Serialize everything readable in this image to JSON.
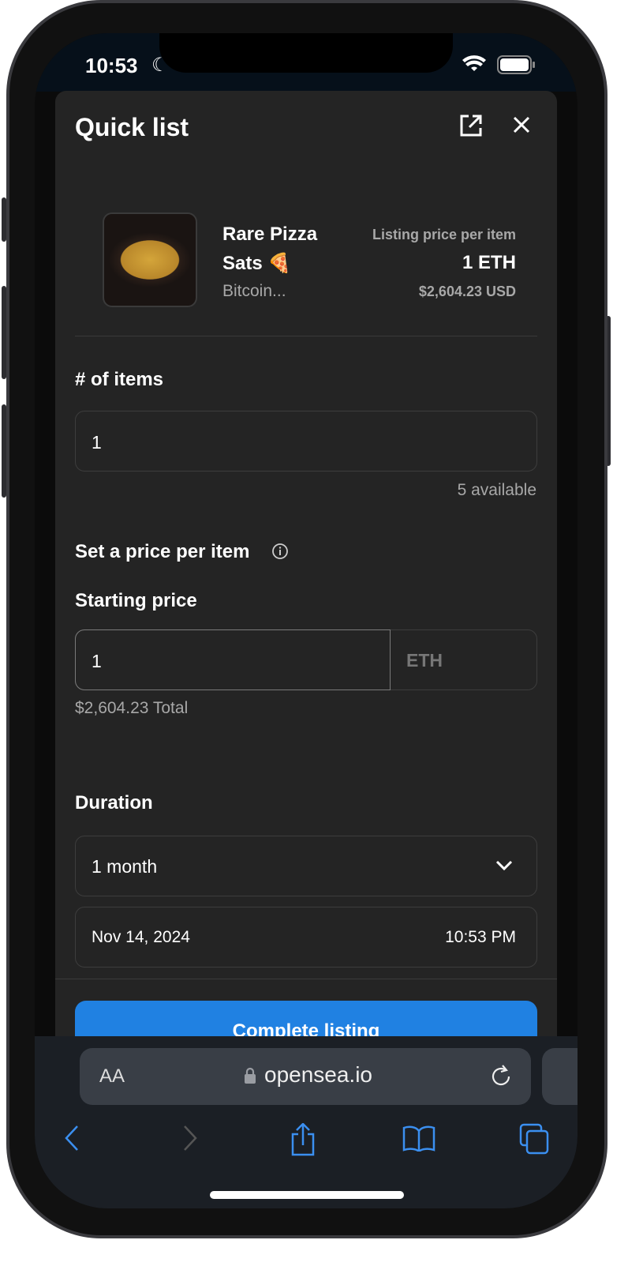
{
  "status_bar": {
    "time": "10:53"
  },
  "modal": {
    "title": "Quick list",
    "item": {
      "name_line1": "Rare Pizza",
      "name_line2": "Sats 🍕",
      "collection": "Bitcoin...",
      "price_label": "Listing price per item",
      "price": "1 ETH",
      "price_usd": "$2,604.23 USD"
    },
    "items_label": "# of items",
    "items_value": "1",
    "available": "5 available",
    "set_price_label": "Set a price per item",
    "starting_price_label": "Starting price",
    "starting_price_value": "1",
    "currency": "ETH",
    "total": "$2,604.23 Total",
    "duration_label": "Duration",
    "duration_value": "1 month",
    "end_date": "Nov 14, 2024",
    "end_time": "10:53 PM",
    "submit_label": "Complete listing"
  },
  "browser": {
    "aa_label": "AA",
    "url": "opensea.io"
  },
  "colors": {
    "accent": "#2081e2",
    "modal_bg": "#242424",
    "toolbar_icon": "#3b8ff0"
  }
}
